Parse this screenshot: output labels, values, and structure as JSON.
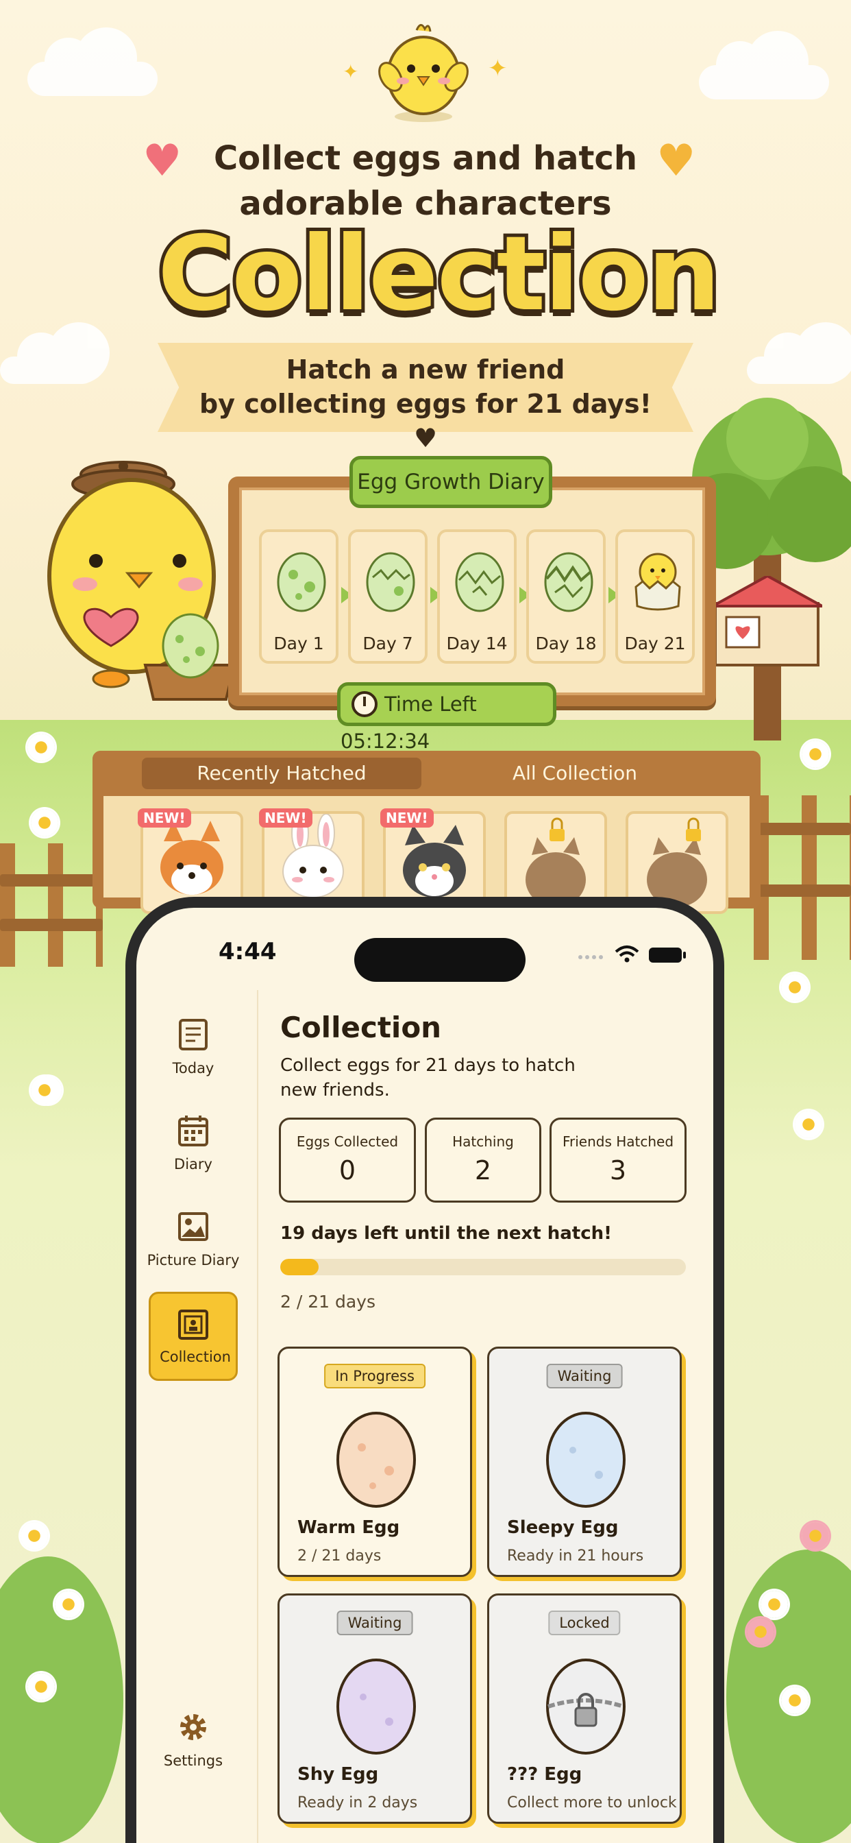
{
  "header": {
    "tagline_line1": "Collect eggs and hatch",
    "tagline_line2": "adorable characters",
    "title": "Collection",
    "ribbon_line1": "Hatch a new friend",
    "ribbon_line2": "by collecting eggs for 21 days! ♥"
  },
  "diary": {
    "title": "Egg Growth Diary",
    "days": [
      {
        "label": "Day 1"
      },
      {
        "label": "Day 7"
      },
      {
        "label": "Day 14"
      },
      {
        "label": "Day 18"
      },
      {
        "label": "Day 21"
      }
    ],
    "timer": "Time Left 05:12:34"
  },
  "shelf": {
    "tabs": [
      "Recently Hatched",
      "All Collection"
    ],
    "badge": "NEW!"
  },
  "phone": {
    "time": "4:44",
    "nav": {
      "today": "Today",
      "diary": "Diary",
      "picture_diary": "Picture Diary",
      "collection": "Collection",
      "settings": "Settings"
    },
    "title": "Collection",
    "subtitle": "Collect eggs for 21 days to hatch new friends.",
    "stats": [
      {
        "label": "Eggs Collected",
        "value": "0"
      },
      {
        "label": "Hatching",
        "value": "2"
      },
      {
        "label": "Friends Hatched",
        "value": "3"
      }
    ],
    "countdown": "19 days left until the next hatch!",
    "progress": {
      "current": 2,
      "total": 21,
      "text": "2 / 21 days"
    },
    "eggs": [
      {
        "status": "In Progress",
        "name": "Warm Egg",
        "sub": "2 / 21 days",
        "color": "#f8dcc2"
      },
      {
        "status": "Waiting",
        "name": "Sleepy Egg",
        "sub": "Ready in 21 hours",
        "color": "#d9e8f7"
      },
      {
        "status": "Waiting",
        "name": "Shy Egg",
        "sub": "Ready in 2 days",
        "color": "#e4d8f2"
      },
      {
        "status": "Locked",
        "name": "??? Egg",
        "sub": "Collect more to unlock",
        "color": "#efefef"
      }
    ]
  },
  "colors": {
    "accent": "#f7c531",
    "wood": "#b77a3d",
    "green": "#9ccc4c"
  }
}
